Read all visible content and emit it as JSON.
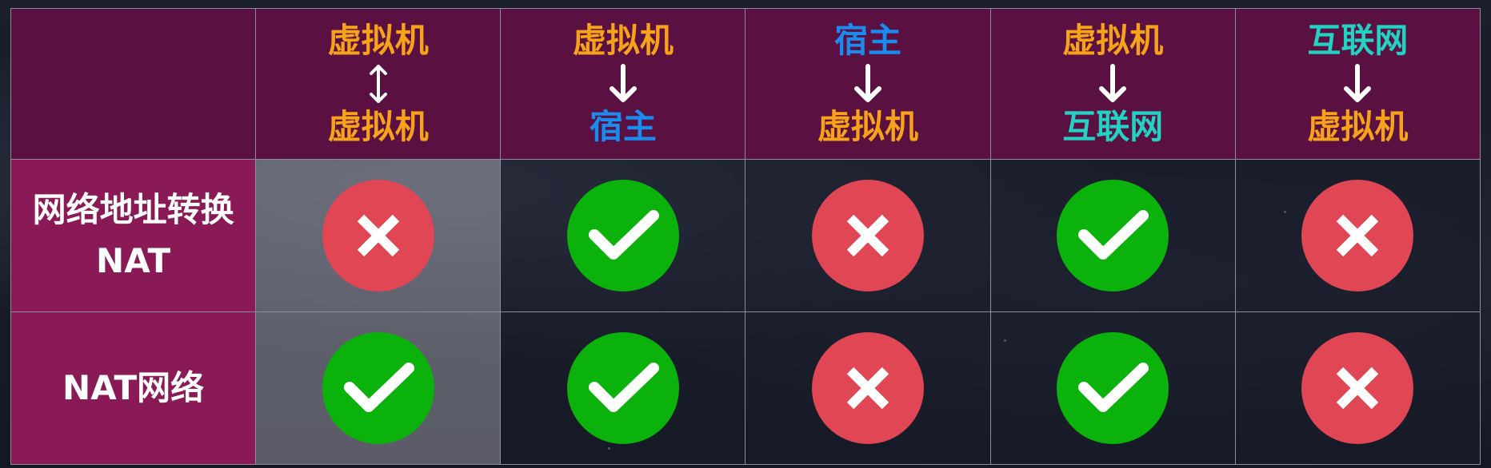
{
  "table": {
    "columns": [
      {
        "from": "虚拟机",
        "to": "虚拟机",
        "from_class": "c-vm",
        "to_class": "c-vm",
        "arrow": "double-vertical-arrow"
      },
      {
        "from": "虚拟机",
        "to": "宿主",
        "from_class": "c-vm",
        "to_class": "c-host",
        "arrow": "down-arrow"
      },
      {
        "from": "宿主",
        "to": "虚拟机",
        "from_class": "c-host",
        "to_class": "c-vm",
        "arrow": "down-arrow"
      },
      {
        "from": "虚拟机",
        "to": "互联网",
        "from_class": "c-vm",
        "to_class": "c-net",
        "arrow": "down-arrow"
      },
      {
        "from": "互联网",
        "to": "虚拟机",
        "from_class": "c-net",
        "to_class": "c-vm",
        "arrow": "down-arrow"
      }
    ],
    "rows": [
      {
        "label_line1": "网络地址转换",
        "label_line2": "NAT",
        "values": [
          "no",
          "yes",
          "no",
          "yes",
          "no"
        ]
      },
      {
        "label_line1": "NAT网络",
        "label_line2": "",
        "values": [
          "yes",
          "yes",
          "no",
          "yes",
          "no"
        ]
      }
    ]
  },
  "colors": {
    "vm": "#f6a21a",
    "host": "#1a8cf0",
    "internet": "#23d2c3",
    "header_bg": "#5a1040",
    "row_label_bg": "#8a1a56",
    "yes": "#0bb20b",
    "no": "#e04653"
  },
  "icons": {
    "yes": "check-icon",
    "no": "cross-icon"
  }
}
